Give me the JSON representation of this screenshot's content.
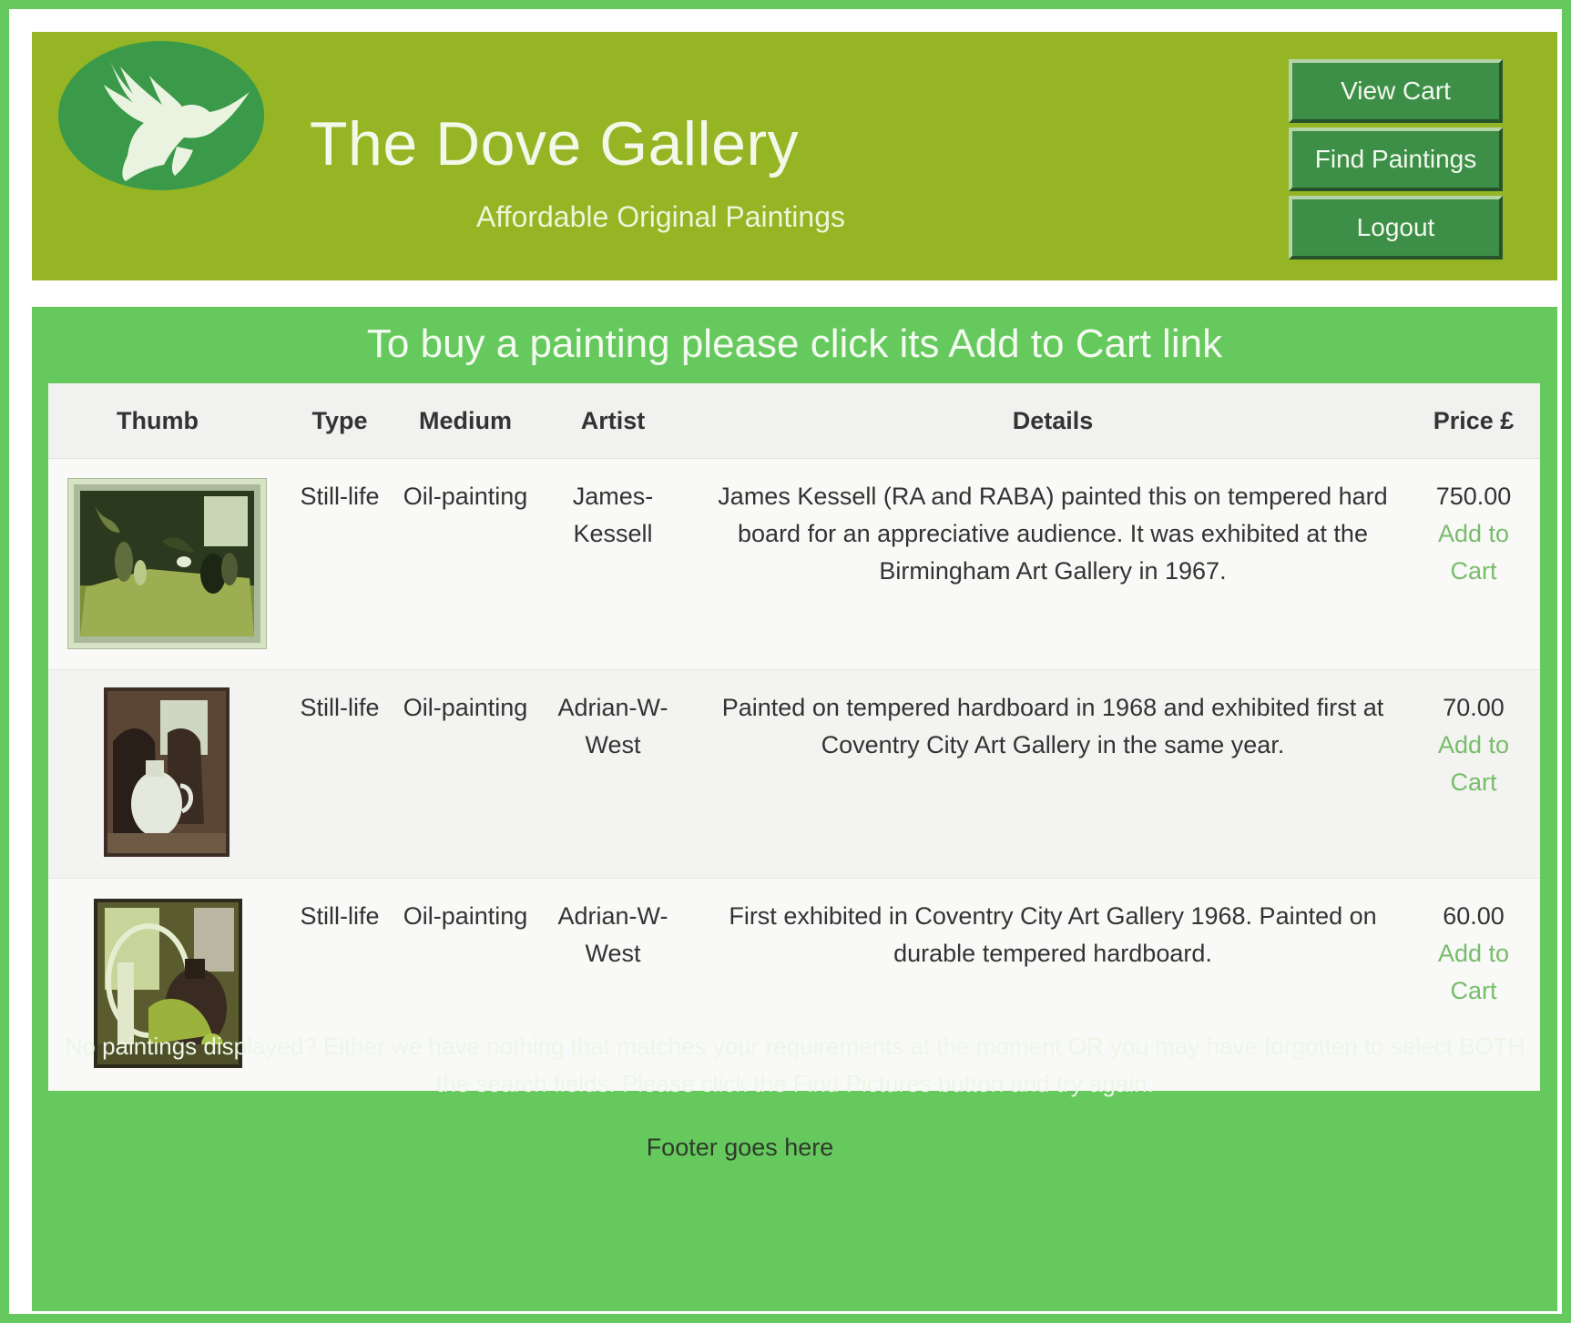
{
  "header": {
    "title": "The Dove Gallery",
    "subtitle": "Affordable Original Paintings",
    "logo_icon": "dove-logo-icon",
    "nav": {
      "view_cart": "View Cart",
      "find_paintings": "Find Paintings",
      "logout": "Logout"
    }
  },
  "main": {
    "heading": "To buy a painting please click its Add to Cart link",
    "table": {
      "columns": [
        "Thumb",
        "Type",
        "Medium",
        "Artist",
        "Details",
        "Price £"
      ],
      "rows": [
        {
          "type": "Still-life",
          "medium": "Oil-painting",
          "artist": "James-Kessell",
          "details": "James Kessell (RA and RABA) painted this on tempered hard board for an appreciative audience. It was exhibited at the Birmingham Art Gallery in 1967.",
          "price": "750.00",
          "link": "Add to Cart"
        },
        {
          "type": "Still-life",
          "medium": "Oil-painting",
          "artist": "Adrian-W-West",
          "details": "Painted on tempered hardboard in 1968 and exhibited first at Coventry City Art Gallery in the same year.",
          "price": "70.00",
          "link": "Add to Cart"
        },
        {
          "type": "Still-life",
          "medium": "Oil-painting",
          "artist": "Adrian-W-West",
          "details": "First exhibited in Coventry City Art Gallery 1968. Painted on durable tempered hardboard.",
          "price": "60.00",
          "link": "Add to Cart"
        }
      ]
    },
    "note": "No paintings displayed? Either we have nothing that matches your requirements at the moment OR you may have forgotten to select BOTH the search fields. Please click the Find Pictures button and try again.",
    "footer": "Footer goes here"
  },
  "colors": {
    "page_border": "#66c95e",
    "header_bg": "#95b525",
    "main_bg": "#66c95e",
    "button_bg": "#3d8f47",
    "link": "#77bd6a"
  }
}
